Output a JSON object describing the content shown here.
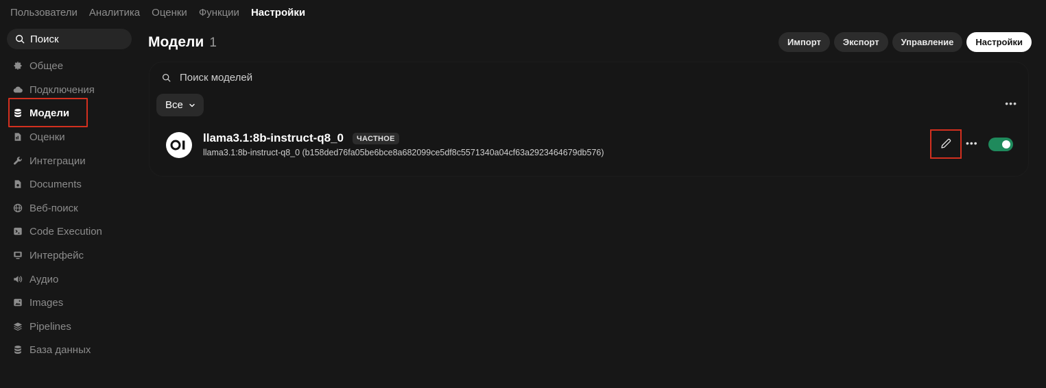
{
  "topnav": {
    "items": [
      {
        "label": "Пользователи",
        "active": false
      },
      {
        "label": "Аналитика",
        "active": false
      },
      {
        "label": "Оценки",
        "active": false
      },
      {
        "label": "Функции",
        "active": false
      },
      {
        "label": "Настройки",
        "active": true
      }
    ]
  },
  "sidebar": {
    "search_label": "Поиск",
    "items": [
      {
        "label": "Общее",
        "icon": "gear-icon"
      },
      {
        "label": "Подключения",
        "icon": "cloud-icon"
      },
      {
        "label": "Модели",
        "icon": "database-icon",
        "active": true
      },
      {
        "label": "Оценки",
        "icon": "document-icon"
      },
      {
        "label": "Интеграции",
        "icon": "wrench-icon"
      },
      {
        "label": "Documents",
        "icon": "file-icon"
      },
      {
        "label": "Веб-поиск",
        "icon": "globe-icon"
      },
      {
        "label": "Code Execution",
        "icon": "terminal-icon"
      },
      {
        "label": "Интерфейс",
        "icon": "monitor-icon"
      },
      {
        "label": "Аудио",
        "icon": "speaker-icon"
      },
      {
        "label": "Images",
        "icon": "image-icon"
      },
      {
        "label": "Pipelines",
        "icon": "layers-icon"
      },
      {
        "label": "База данных",
        "icon": "database-icon"
      }
    ]
  },
  "main": {
    "title": "Модели",
    "count": "1",
    "actions": {
      "import": "Импорт",
      "export": "Экспорт",
      "manage": "Управление",
      "settings": "Настройки"
    },
    "search_placeholder": "Поиск моделей",
    "filter_label": "Все",
    "models": [
      {
        "avatar_text": "OI",
        "name": "llama3.1:8b-instruct-q8_0",
        "badge": "ЧАСТНОЕ",
        "description": "llama3.1:8b-instruct-q8_0 (b158ded76fa05be6bce8a682099ce5df8c5571340a04cf63a2923464679db576)",
        "enabled": true
      }
    ]
  },
  "colors": {
    "background": "#171717",
    "highlight": "#d4301f",
    "toggle_on": "#1f8a5c"
  }
}
